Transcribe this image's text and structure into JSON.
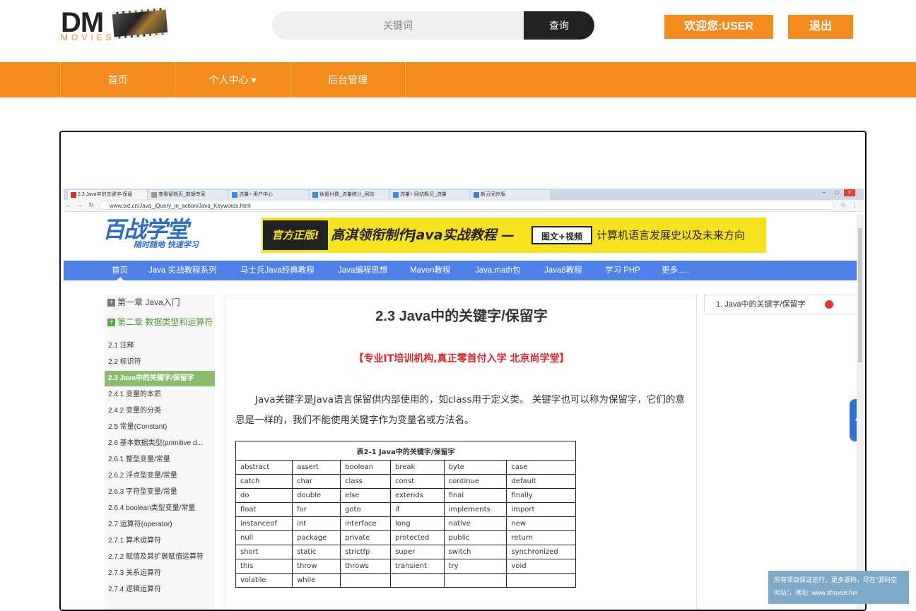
{
  "header": {
    "logo_main": "DM",
    "logo_sub": "MOVIES",
    "search": {
      "placeholder": "关键词",
      "button": "查询"
    },
    "welcome": "欢迎您:USER",
    "logout": "退出"
  },
  "nav": {
    "items": [
      {
        "label": "首页"
      },
      {
        "label": "个人中心 ▾"
      },
      {
        "label": "后台管理"
      }
    ]
  },
  "screenshot": {
    "browser": {
      "tabs": [
        "2.3 Java中的关键字/保留",
        "查看留档页_数据专家",
        "流量+ 用户中心",
        "钛氪付费_流量统计_网站",
        "流量+ 网站概况_流量",
        "新云同步版"
      ],
      "url": "www.sxt.cn/Java_jQuery_in_action/Java_Keywords.html"
    },
    "site": {
      "logo_main": "百战学堂",
      "logo_sub": "随时随地 快速学习",
      "banner": {
        "badge": "官方正版!",
        "title": "高淇领衔制作java实战教程 —",
        "box": "图文+视频",
        "tail": "计算机语言发展史以及未来方向"
      },
      "nav": [
        "首页",
        "Java 实战教程系列",
        "马士兵Java经典教程",
        "Java编程思想",
        "Maven教程",
        "Java.math包",
        "Java8教程",
        "学习 PHP",
        "更多....."
      ],
      "sidebar": {
        "chapter1": "第一章 Java入门",
        "chapter2": "第二章 数据类型和运算符",
        "items": [
          "2.1 注释",
          "2.2 标识符",
          "2.3 Java中的关键字/保留字",
          "2.4.1 变量的本质",
          "2.4.2 变量的分类",
          "2.5 常量(Constant)",
          "2.6 基本数据类型(primitive d...",
          "2.6.1 整型变量/常量",
          "2.6.2 浮点型变量/常量",
          "2.6.3 字符型变量/常量",
          "2.6.4 boolean类型变量/常量",
          "2.7 运算符(operator)",
          "2.7.1 算术运算符",
          "2.7.2 赋值及其扩展赋值运算符",
          "2.7.3 关系运算符",
          "2.7.4 逻辑运算符"
        ]
      },
      "article": {
        "title": "2.3 Java中的关键字/保留字",
        "slogan": "【专业IT培训机构,真正零首付入学 北京尚学堂】",
        "paragraph": "Java关键字是Java语言保留供内部使用的，如class用于定义类。 关键字也可以称为保留字，它们的意思是一样的，我们不能使用关键字作为变量名或方法名。",
        "table_caption": "表2-1 Java中的关键字/保留字",
        "table_rows": [
          [
            "abstract",
            "assert",
            "boolean",
            "break",
            "byte",
            "case"
          ],
          [
            "catch",
            "char",
            "class",
            "const",
            "continue",
            "default"
          ],
          [
            "do",
            "double",
            "else",
            "extends",
            "final",
            "finally"
          ],
          [
            "float",
            "for",
            "goto",
            "if",
            "implements",
            "import"
          ],
          [
            "instanceof",
            "int",
            "interface",
            "long",
            "native",
            "new"
          ],
          [
            "null",
            "package",
            "private",
            "protected",
            "public",
            "return"
          ],
          [
            "short",
            "static",
            "strictfp",
            "super",
            "switch",
            "synchronized"
          ],
          [
            "this",
            "throw",
            "throws",
            "transient",
            "try",
            "void"
          ],
          [
            "volatile",
            "while",
            "",
            "",
            "",
            ""
          ]
        ]
      },
      "toc_item": "1. Java中的关键字/保留字"
    }
  },
  "footer_note": "所有项目保证运行，更多源码，尽在\"源码空间站\"，地址: www.shuyue.fun"
}
